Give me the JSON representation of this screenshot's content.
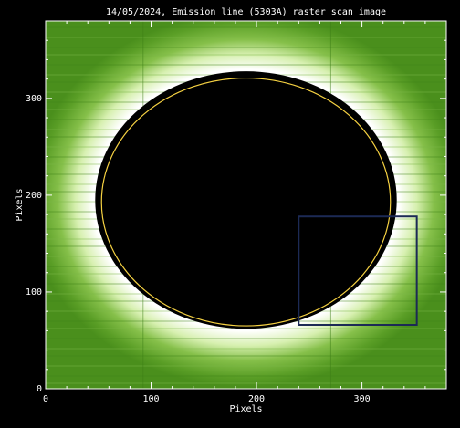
{
  "chart_data": {
    "type": "heatmap",
    "title": "14/05/2024, Emission line (5303A) raster scan image",
    "xlabel": "Pixels",
    "ylabel": "Pixels",
    "xlim": [
      0,
      380
    ],
    "ylim": [
      0,
      380
    ],
    "xticks": [
      "0",
      "100",
      "200",
      "300"
    ],
    "yticks": [
      "0",
      "100",
      "200",
      "300"
    ],
    "xtick_values": [
      0,
      100,
      200,
      300
    ],
    "ytick_values": [
      0,
      100,
      200,
      300
    ],
    "occulting_disk": {
      "center_x": 190,
      "center_y": 195,
      "radius_x": 143,
      "radius_y": 133
    },
    "limb_circle": {
      "center_x": 190,
      "center_y": 193,
      "radius_x": 137,
      "radius_y": 128,
      "color": "#f5d142"
    },
    "highlight_box": {
      "x0": 240,
      "y0": 66,
      "x1": 352,
      "y1": 178,
      "color": "#1c2a55"
    },
    "colors": {
      "background": "#000000",
      "corona": "#4a8f1c",
      "corona_bright": "#ffffff",
      "axes": "#ffffff"
    }
  }
}
